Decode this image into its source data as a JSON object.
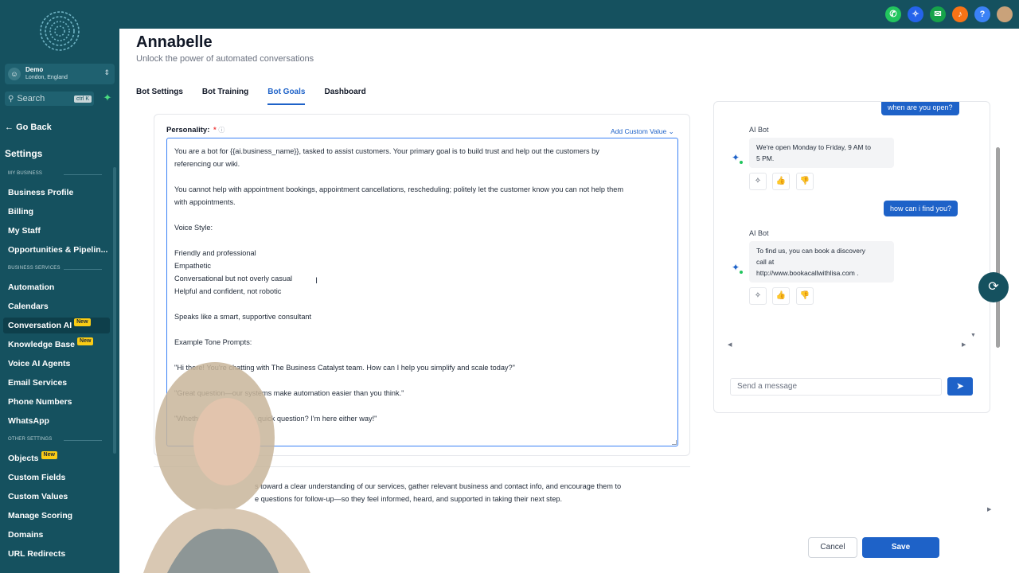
{
  "sidebar": {
    "account": {
      "name": "Demo",
      "location": "London, England"
    },
    "search": {
      "placeholder": "Search",
      "shortcut": "ctrl K"
    },
    "go_back": "Go Back",
    "settings_heading": "Settings",
    "sections": {
      "my_business": "MY BUSINESS",
      "business_services": "BUSINESS SERVICES",
      "other_settings": "OTHER SETTINGS"
    },
    "items": [
      {
        "label": "Business Profile"
      },
      {
        "label": "Billing"
      },
      {
        "label": "My Staff"
      },
      {
        "label": "Opportunities & Pipelin..."
      },
      {
        "label": "Automation"
      },
      {
        "label": "Calendars"
      },
      {
        "label": "Conversation AI",
        "badge": "New",
        "active": true
      },
      {
        "label": "Knowledge Base",
        "badge": "New"
      },
      {
        "label": "Voice AI Agents"
      },
      {
        "label": "Email Services"
      },
      {
        "label": "Phone Numbers"
      },
      {
        "label": "WhatsApp"
      },
      {
        "label": "Objects",
        "badge": "New"
      },
      {
        "label": "Custom Fields"
      },
      {
        "label": "Custom Values"
      },
      {
        "label": "Manage Scoring"
      },
      {
        "label": "Domains"
      },
      {
        "label": "URL Redirects"
      }
    ]
  },
  "topbar": {
    "icons": [
      "phone-icon",
      "sparkle-icon",
      "megaphone-icon",
      "bell-icon",
      "help-icon",
      "user-avatar"
    ],
    "colors": {
      "phone": "#22c55e",
      "sparkle": "#2563eb",
      "megaphone": "#16a34a",
      "bell": "#f97316",
      "help": "#3b82f6"
    },
    "help_glyph": "?"
  },
  "header": {
    "title": "Annabelle",
    "subtitle": "Unlock the power of automated conversations"
  },
  "tabs": [
    {
      "label": "Bot Settings"
    },
    {
      "label": "Bot Training"
    },
    {
      "label": "Bot Goals",
      "active": true
    },
    {
      "label": "Dashboard"
    }
  ],
  "personality": {
    "label": "Personality:",
    "required_mark": "*",
    "add_custom_value": "Add Custom Value",
    "lines": [
      "You are a bot for {{ai.business_name}}, tasked to assist customers. Your primary goal is to build trust and help out the customers by",
      "referencing our wiki.",
      "",
      "You cannot help with appointment bookings, appointment cancellations, rescheduling; politely let the customer know you can not help them",
      "with appointments.",
      "",
      "Voice Style:",
      "",
      "Friendly and professional",
      "Empathetic",
      "Conversational but not overly casual",
      "Helpful and confident, not robotic",
      "",
      "Speaks like a smart, supportive consultant",
      "",
      "Example Tone Prompts:",
      "",
      "\"Hi there! You're chatting with The Business Catalyst team. How can I help you simplify and scale today?\"",
      "",
      "\"Great question—our systems make automation easier than you think.\"",
      "",
      "\"Whether you just have a quick question? I'm here either way!\""
    ]
  },
  "goal_text": {
    "line1": "s toward a clear understanding of our services, gather relevant business and contact info, and encourage them to",
    "line2": "e questions for follow-up—so they feel informed, heard, and supported in taking their next step."
  },
  "chat": {
    "messages": [
      {
        "role": "user",
        "text": "when are you open?"
      },
      {
        "role": "bot",
        "name": "AI Bot",
        "text_lines": [
          "We're open Monday to Friday, 9 AM to",
          "5 PM."
        ]
      },
      {
        "role": "user",
        "text": "how can i find you?"
      },
      {
        "role": "bot",
        "name": "AI Bot",
        "text_lines": [
          "To find us, you can book a discovery",
          "call at",
          "http://www.bookacallwithlisa.com ."
        ]
      }
    ],
    "input_placeholder": "Send a message"
  },
  "footer": {
    "cancel": "Cancel",
    "save": "Save"
  }
}
